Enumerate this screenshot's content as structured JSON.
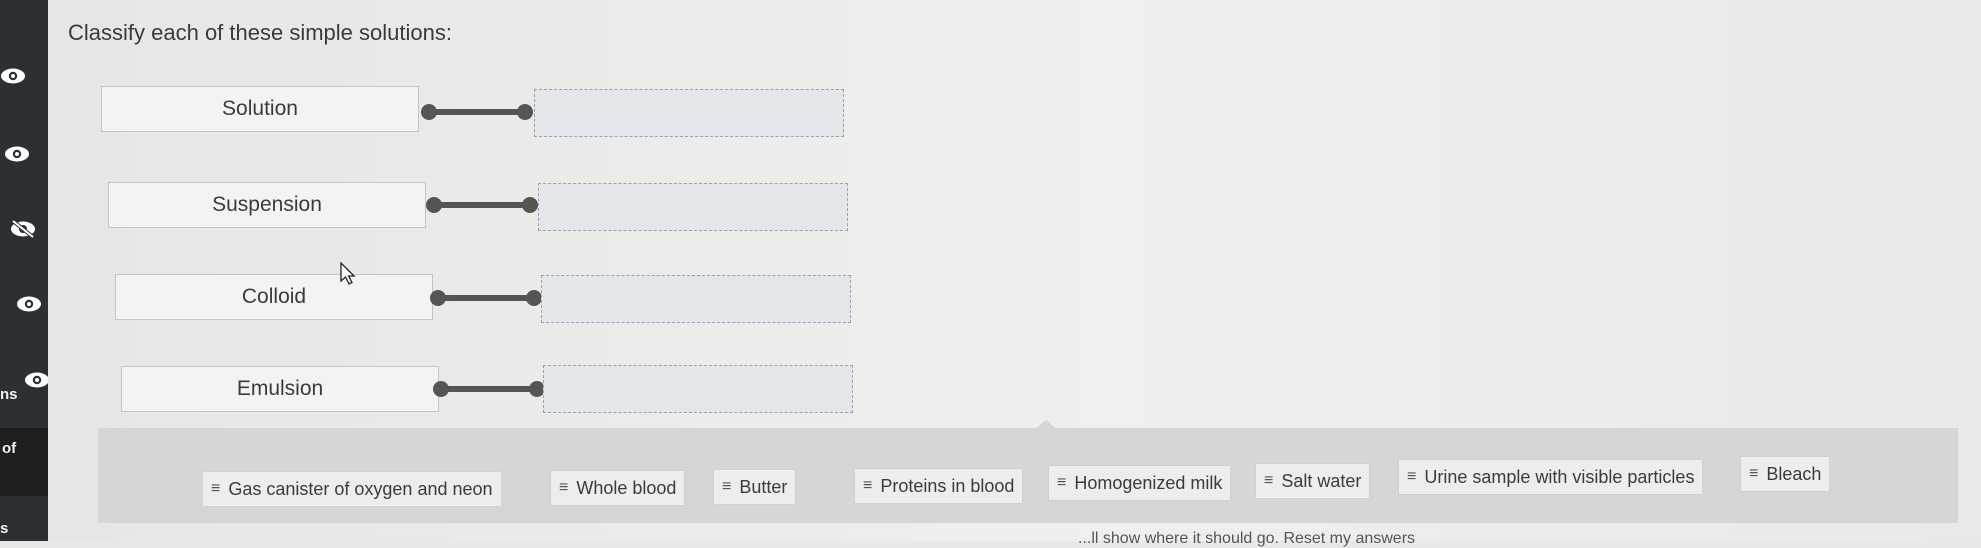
{
  "sidebar": {
    "labels": [
      "ns",
      "of",
      "s"
    ]
  },
  "question": {
    "title": "Classify each of these simple solutions:"
  },
  "terms": [
    {
      "label": "Solution"
    },
    {
      "label": "Suspension"
    },
    {
      "label": "Colloid"
    },
    {
      "label": "Emulsion"
    }
  ],
  "answers": [
    {
      "label": "Gas canister of oxygen and neon"
    },
    {
      "label": "Whole blood"
    },
    {
      "label": "Butter"
    },
    {
      "label": "Proteins in blood"
    },
    {
      "label": "Homogenized milk"
    },
    {
      "label": "Salt water"
    },
    {
      "label": "Urine sample with visible particles"
    },
    {
      "label": "Bleach"
    }
  ],
  "footer": {
    "partial_text": "...ll show where it should go. Reset my answers"
  },
  "icons": {
    "sidebar": [
      "eye-icon",
      "eye-icon",
      "eye-slash-icon",
      "eye-icon",
      "eye-icon"
    ],
    "chip_grip": "grip-lines-icon",
    "cursor": "mouse-cursor-icon"
  },
  "colors": {
    "sidebar": "#2c2f33",
    "connector": "#555555",
    "dropzone": "#e4e7ea",
    "tray": "#d6d6d4"
  }
}
